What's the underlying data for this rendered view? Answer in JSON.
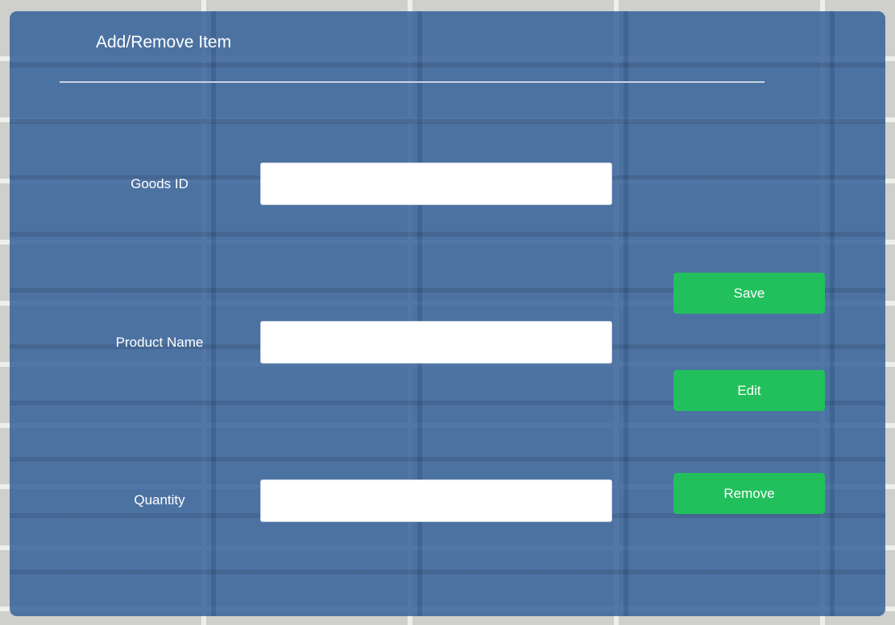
{
  "form": {
    "title": "Add/Remove Item",
    "fields": [
      {
        "label": "Goods ID",
        "value": "",
        "placeholder": ""
      },
      {
        "label": "Product Name",
        "value": "",
        "placeholder": ""
      },
      {
        "label": "Quantity",
        "value": "",
        "placeholder": ""
      }
    ],
    "buttons": {
      "save": "Save",
      "edit": "Edit",
      "remove": "Remove"
    }
  },
  "colors": {
    "panel": "#2c5a96",
    "button": "#22c05c",
    "text": "#ffffff"
  }
}
